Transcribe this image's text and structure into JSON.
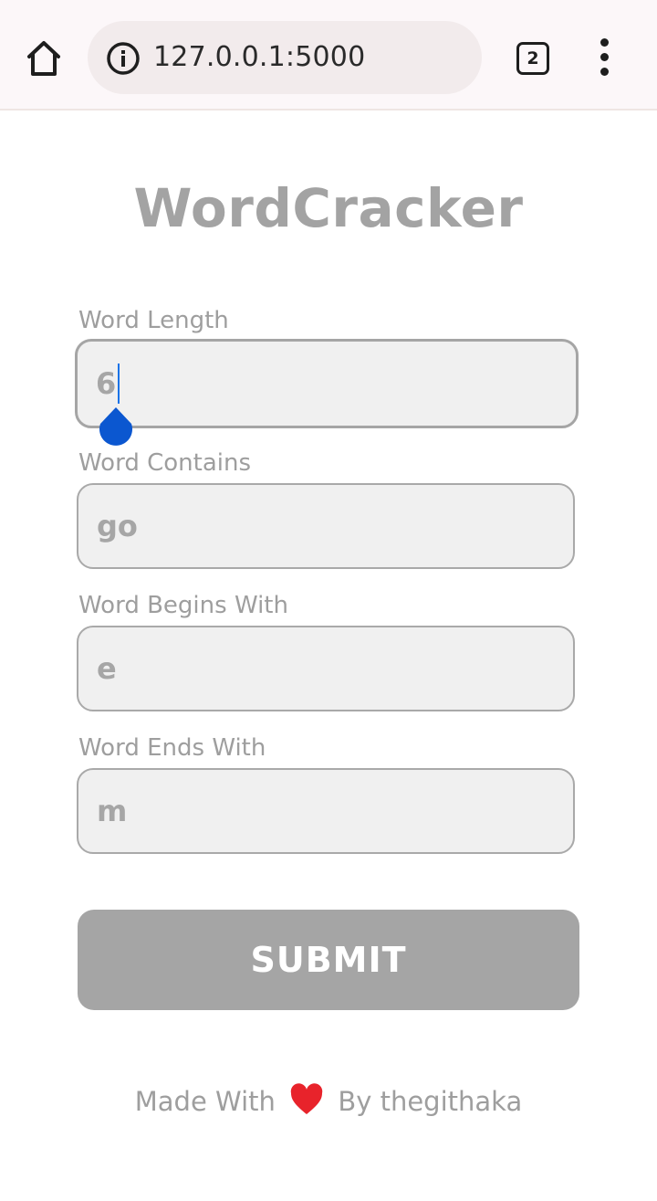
{
  "browser": {
    "url": "127.0.0.1:5000",
    "tab_count": "2"
  },
  "page": {
    "title": "WordCracker",
    "fields": [
      {
        "label": "Word Length",
        "value": "6"
      },
      {
        "label": "Word Contains",
        "value": "go"
      },
      {
        "label": "Word Begins With",
        "value": "e"
      },
      {
        "label": "Word Ends With",
        "value": "m"
      }
    ],
    "submit_label": "SUBMIT",
    "footer": {
      "prefix": "Made With",
      "suffix": "By thegithaka"
    }
  },
  "colors": {
    "accent_caret": "#1a73e8",
    "heart": "#e8232b",
    "button": "#a5a5a5"
  }
}
